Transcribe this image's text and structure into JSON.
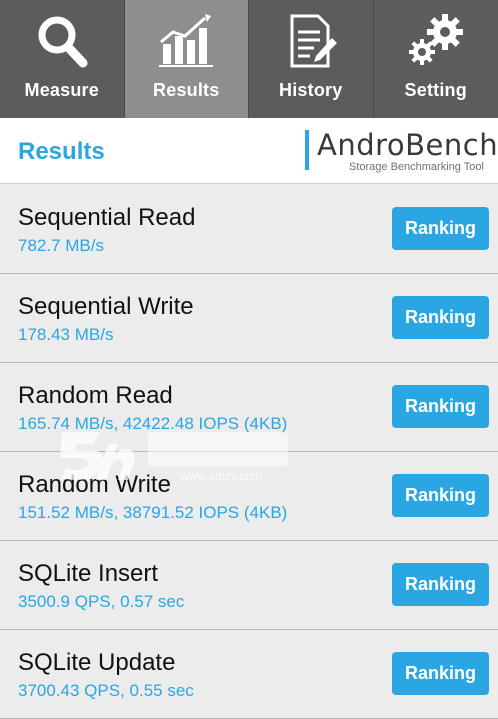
{
  "tabs": [
    {
      "label": "Measure",
      "icon": "search-icon",
      "active": false
    },
    {
      "label": "Results",
      "icon": "chart-icon",
      "active": true
    },
    {
      "label": "History",
      "icon": "document-icon",
      "active": false
    },
    {
      "label": "Setting",
      "icon": "gears-icon",
      "active": false
    }
  ],
  "header": {
    "title": "Results",
    "logo_andro": "Andro",
    "logo_bench": "Bench",
    "logo_subtitle": "Storage Benchmarking Tool"
  },
  "results": [
    {
      "name": "Sequential Read",
      "value": "782.7 MB/s",
      "button": "Ranking"
    },
    {
      "name": "Sequential Write",
      "value": "178.43 MB/s",
      "button": "Ranking"
    },
    {
      "name": "Random Read",
      "value": "165.74 MB/s, 42422.48 IOPS (4KB)",
      "button": "Ranking"
    },
    {
      "name": "Random Write",
      "value": "151.52 MB/s, 38791.52 IOPS (4KB)",
      "button": "Ranking"
    },
    {
      "name": "SQLite Insert",
      "value": "3500.9 QPS, 0.57 sec",
      "button": "Ranking"
    },
    {
      "name": "SQLite Update",
      "value": "3700.43 QPS, 0.55 sec",
      "button": "Ranking"
    }
  ],
  "watermark": {
    "text": "www.smzy.com"
  },
  "colors": {
    "accent": "#2aa6e2",
    "tabbar": "#5c5c5c",
    "tab_active": "#8e8e8e"
  }
}
